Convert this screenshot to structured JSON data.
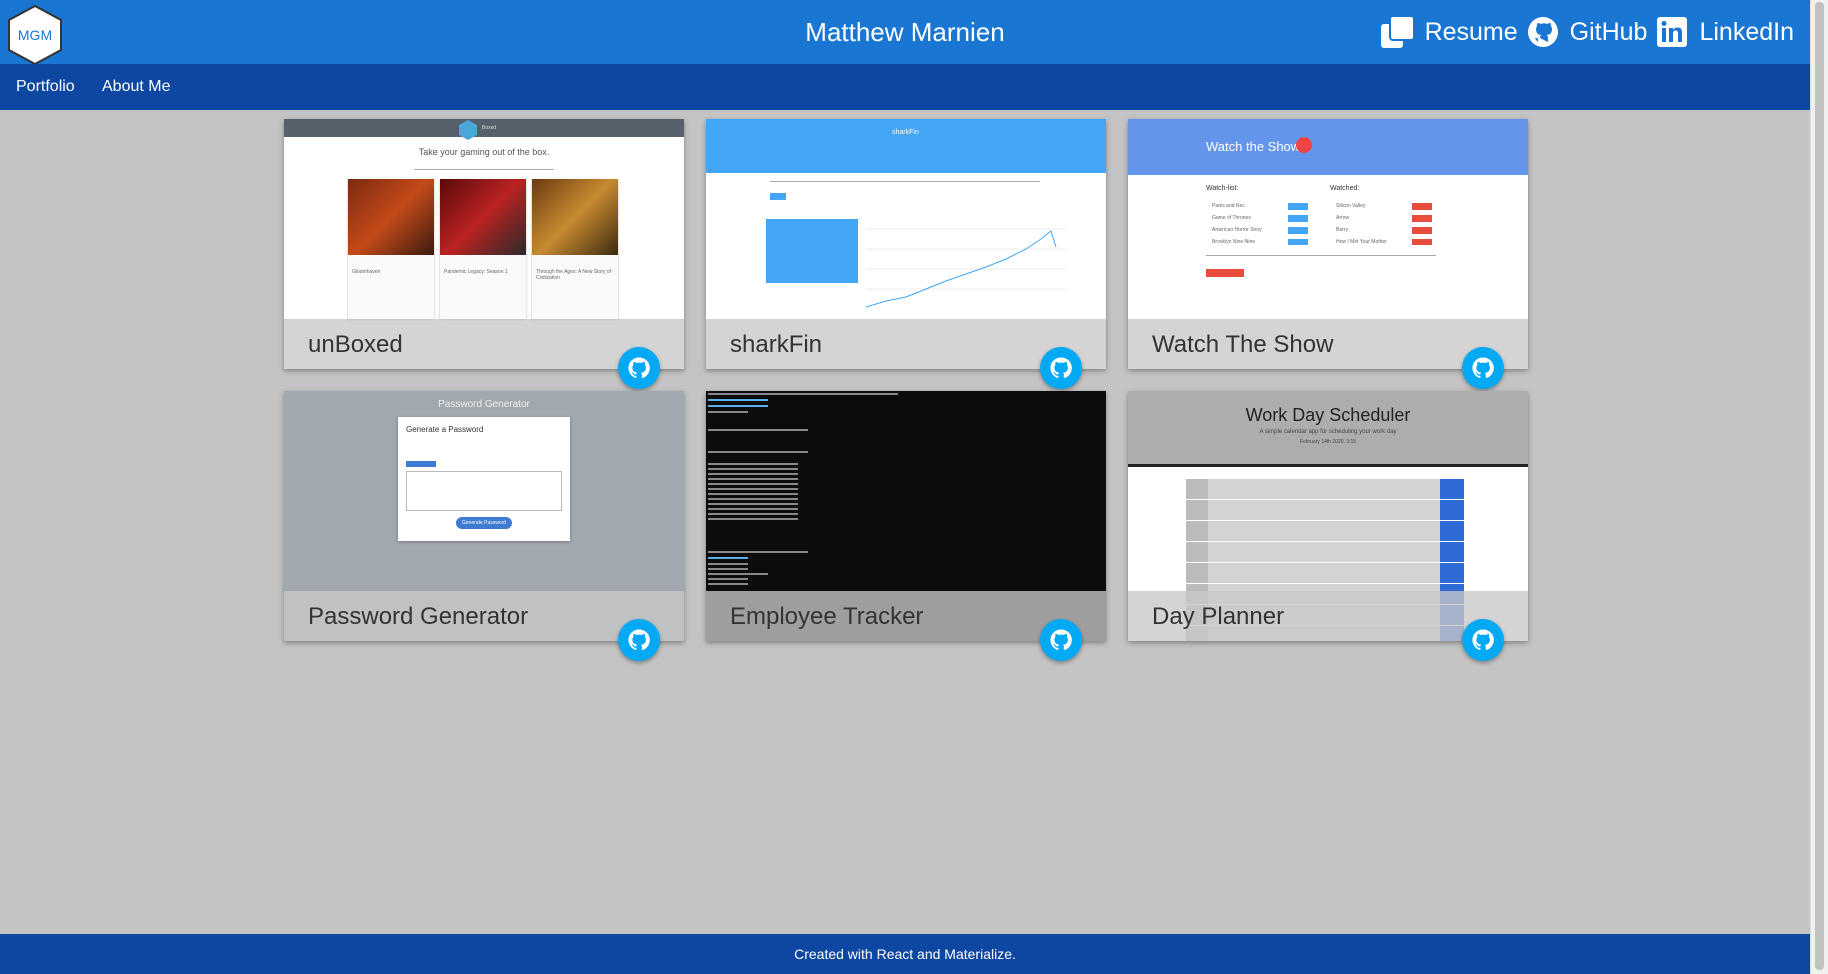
{
  "header": {
    "logo_text": "MGM",
    "title": "Matthew Marnien",
    "links": [
      {
        "label": "Resume",
        "icon": "copy-icon"
      },
      {
        "label": "GitHub",
        "icon": "github-icon"
      },
      {
        "label": "LinkedIn",
        "icon": "linkedin-icon"
      }
    ]
  },
  "nav": {
    "items": [
      {
        "label": "Portfolio"
      },
      {
        "label": "About Me"
      }
    ]
  },
  "projects": [
    {
      "title": "unBoxed",
      "preview": {
        "tagline": "Take your gaming out of the box.",
        "brand": "Boxed",
        "games": [
          "Gloomhaven",
          "Pandemic Legacy: Season 1",
          "Through the Ages: A New Story of Civilization"
        ]
      }
    },
    {
      "title": "sharkFin",
      "preview": {
        "brand": "sharkFin"
      }
    },
    {
      "title": "Watch The Show",
      "preview": {
        "heading": "Watch the Show",
        "watchlist_label": "Watch-list:",
        "watched_label": "Watched:",
        "watchlist": [
          "Parks and Rec",
          "Game of Thrones",
          "American Horror Story",
          "Brooklyn Nine-Nine"
        ],
        "watched": [
          "Silicon Valley",
          "Arrow",
          "Barry",
          "How I Met Your Mother"
        ]
      }
    },
    {
      "title": "Password Generator",
      "preview": {
        "heading": "Password Generator",
        "box_title": "Generate a Password",
        "button": "Generate Password"
      }
    },
    {
      "title": "Employee Tracker",
      "preview": {}
    },
    {
      "title": "Day Planner",
      "preview": {
        "heading": "Work Day Scheduler",
        "subtitle": "A simple calendar app for scheduling your work day",
        "date": "February 14th 2020, 3:15"
      }
    }
  ],
  "footer": {
    "text": "Created with React and Materialize."
  },
  "colors": {
    "primary": "#1976d2",
    "primary_dark": "#0d47a1",
    "github_button": "#03a9f4",
    "page_bg": "#c4c4c4"
  }
}
